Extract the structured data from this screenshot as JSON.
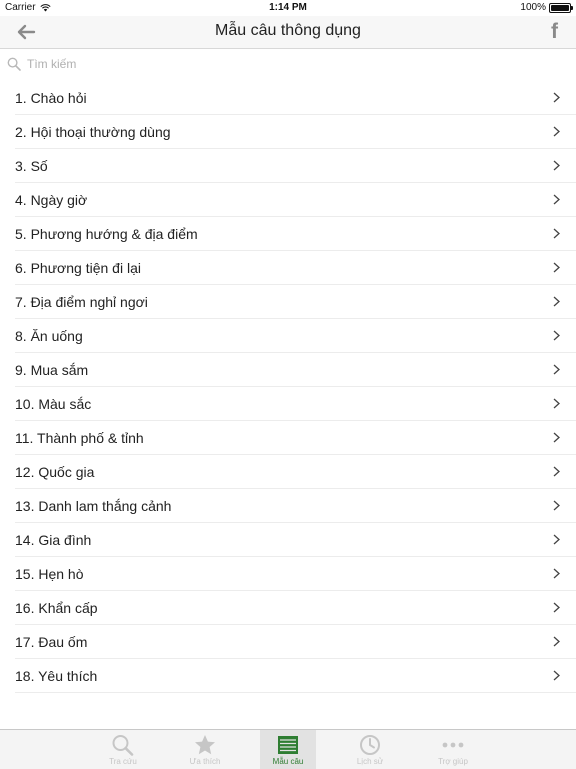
{
  "status_bar": {
    "carrier": "Carrier",
    "time": "1:14 PM",
    "battery": "100%"
  },
  "nav": {
    "title": "Mẫu câu thông dụng",
    "back_icon": "back-arrow-icon",
    "facebook_glyph": "f"
  },
  "search": {
    "placeholder": "Tìm kiếm"
  },
  "list": [
    {
      "label": "1. Chào hỏi"
    },
    {
      "label": "2. Hội thoại thường dùng"
    },
    {
      "label": "3. Số"
    },
    {
      "label": "4. Ngày giờ"
    },
    {
      "label": "5. Phương hướng & địa điểm"
    },
    {
      "label": "6. Phương tiện đi lại"
    },
    {
      "label": "7. Địa điểm nghỉ ngơi"
    },
    {
      "label": "8. Ăn uống"
    },
    {
      "label": "9. Mua sắm"
    },
    {
      "label": "10. Màu sắc"
    },
    {
      "label": "11. Thành phố & tỉnh"
    },
    {
      "label": "12. Quốc gia"
    },
    {
      "label": "13. Danh lam thắng cảnh"
    },
    {
      "label": "14. Gia đình"
    },
    {
      "label": "15. Hẹn hò"
    },
    {
      "label": "16. Khẩn cấp"
    },
    {
      "label": "17. Đau ốm"
    },
    {
      "label": "18. Yêu thích"
    }
  ],
  "tabs": [
    {
      "label": "Tra cứu",
      "icon": "search-icon"
    },
    {
      "label": "Ưa thích",
      "icon": "star-icon"
    },
    {
      "label": "Mẫu câu",
      "icon": "phrasebook-icon",
      "active": true
    },
    {
      "label": "Lịch sử",
      "icon": "clock-icon"
    },
    {
      "label": "Trợ giúp",
      "icon": "more-icon"
    }
  ],
  "colors": {
    "accent": "#2e7d32",
    "tab_inactive": "#c6c6c6",
    "nav_bg": "#f7f7f7"
  }
}
